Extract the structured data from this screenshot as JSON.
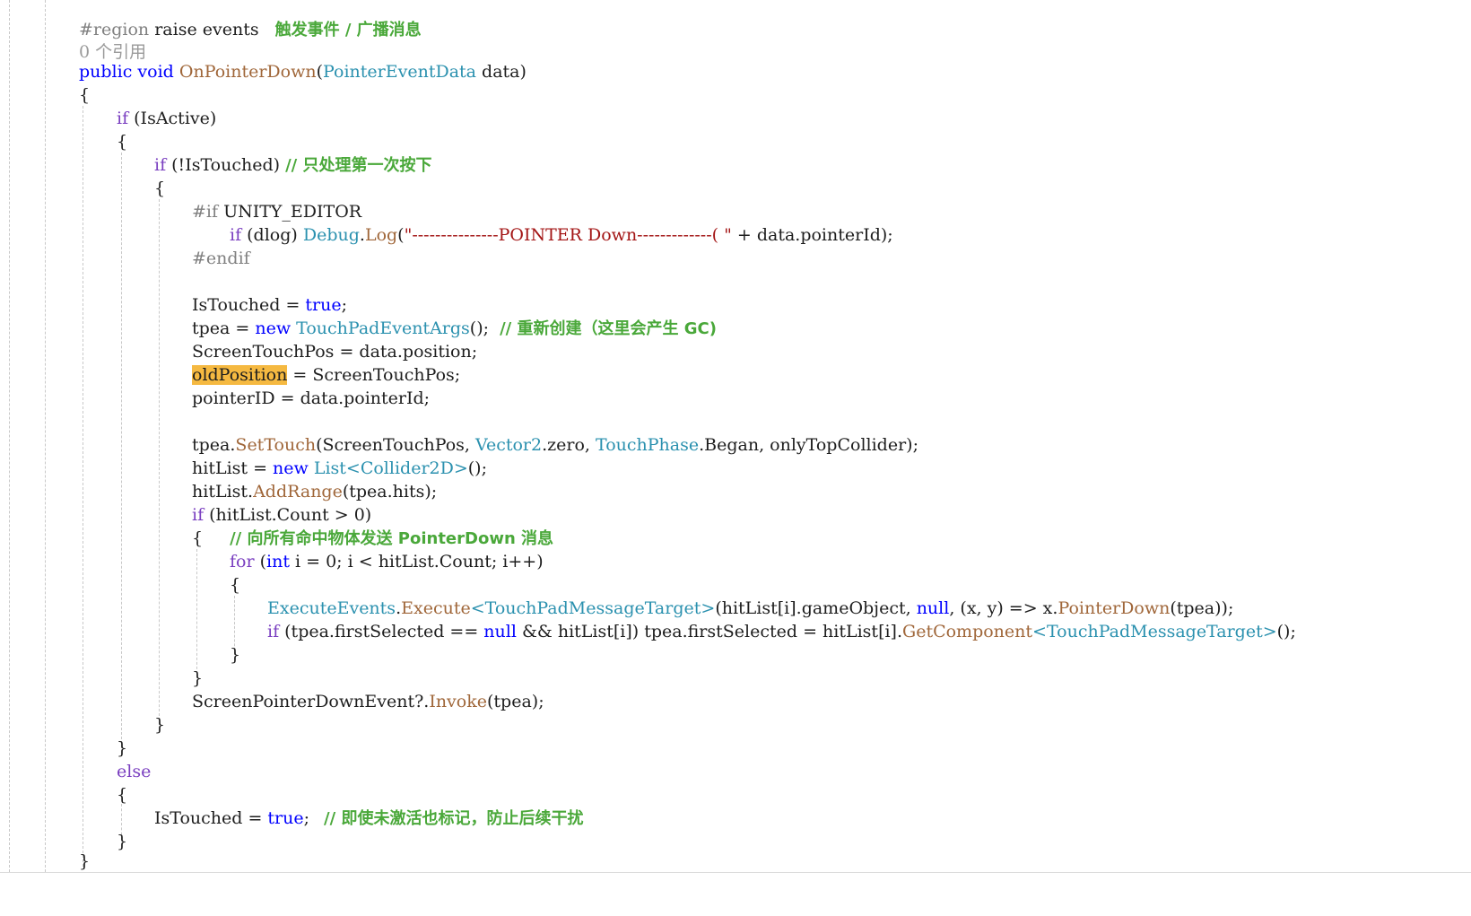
{
  "region": {
    "directive": "#region",
    "name": " raise events",
    "comment": "触发事件 / 广播消息",
    "references": "0 个引用"
  },
  "method": {
    "public": "public",
    "void": "void",
    "name": "OnPointerDown",
    "open_paren": "(",
    "param_type": "PointerEventData",
    "param_rest": " data)"
  },
  "tokens": {
    "open_brace": "{",
    "close_brace": "}",
    "if": "if",
    "else": "else",
    "for": "for",
    "int": "int",
    "new": "new",
    "true": "true",
    "null": "null"
  },
  "lines": {
    "if_active_rest": " (IsActive)",
    "if_touched_rest": " (!IsTouched) ",
    "if_touched_comment": "// 只处理第一次按下",
    "if_unity_editor": "#if",
    "unity_editor_rest": " UNITY_EDITOR",
    "dlog_rest": " (dlog) ",
    "debug_type": "Debug",
    "debug_dot": ".",
    "debug_log": "Log",
    "debug_open": "(",
    "debug_string": "\"---------------POINTER Down-------------( \"",
    "debug_rest": " + data.pointerId);",
    "endif": "#endif",
    "istouched_assign": "IsTouched = ",
    "semicolon": ";",
    "tpea_assign": "tpea = ",
    "tpea_type": "TouchPadEventArgs",
    "tpea_rest": "();  ",
    "tpea_comment": "// 重新创建（这里会产生 GC)",
    "screen_touch_pos": "ScreenTouchPos = data.position;",
    "old_position": "oldPosition",
    "old_position_rest": " = ScreenTouchPos;",
    "pointer_id": "pointerID = data.pointerId;",
    "settouch_a": "tpea.",
    "settouch_m": "SetTouch",
    "settouch_b": "(ScreenTouchPos, ",
    "settouch_t1": "Vector2",
    "settouch_c": ".zero, ",
    "settouch_t2": "TouchPhase",
    "settouch_d": ".Began, onlyTopCollider);",
    "hitlist_assign": "hitList = ",
    "list_type": "List<Collider2D>",
    "hitlist_rest": "();",
    "addrange_a": "hitList.",
    "addrange_m": "AddRange",
    "addrange_b": "(tpea.hits);",
    "count_check_rest": " (hitList.Count > 0)",
    "count_comment": "// 向所有命中物体发送 PointerDown 消息",
    "for_a": " (",
    "for_b": " i = 0; i < hitList.Count; i++)",
    "exec_type": "ExecuteEvents",
    "exec_dot": ".",
    "exec_m": "Execute",
    "exec_generic": "<TouchPadMessageTarget>",
    "exec_b": "(hitList[i].gameObject, ",
    "exec_c": ", (x, y) => x.",
    "exec_m2": "PointerDown",
    "exec_d": "(tpea));",
    "first_sel_a": " (tpea.firstSelected == ",
    "first_sel_b": " && hitList[i]) tpea.firstSelected = hitList[i].",
    "first_sel_m": "GetComponent",
    "first_sel_generic": "<TouchPadMessageTarget>",
    "first_sel_c": "();",
    "invoke_a": "ScreenPointerDownEvent?.",
    "invoke_m": "Invoke",
    "invoke_b": "(tpea);",
    "else_istouched": "IsTouched = ",
    "else_comment": "// 即使未激活也标记，防止后续干扰"
  },
  "colors": {
    "keyword_purple": "#7a3fc0",
    "keyword_blue": "#0000ff",
    "type_teal": "#2b91af",
    "method_brown": "#a0673a",
    "comment_green": "#4aa83a",
    "highlight": "#f5b941"
  }
}
